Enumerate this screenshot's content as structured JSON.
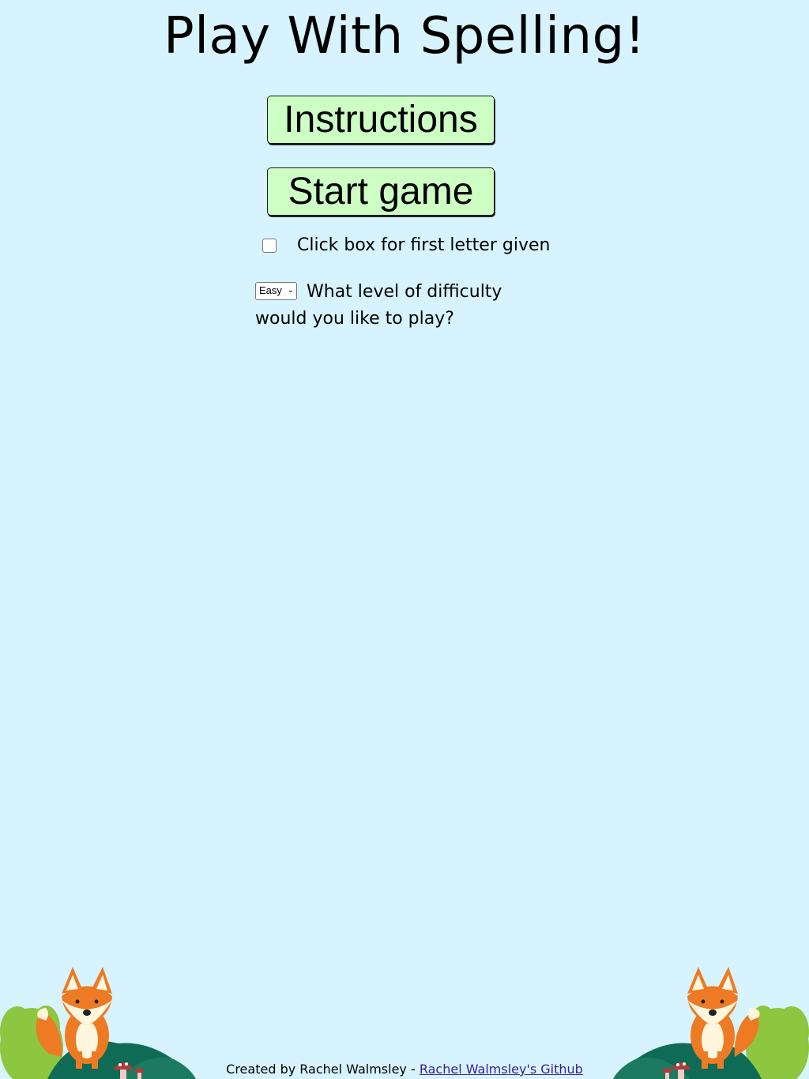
{
  "title": "Play With Spelling!",
  "buttons": {
    "instructions": "Instructions",
    "start_game": "Start game"
  },
  "first_letter": {
    "checked": false,
    "label": "Click box for first letter given"
  },
  "difficulty": {
    "selected": "Easy",
    "label": "What level of difficulty would you like to play?"
  },
  "footer": {
    "created_by": "Created by Rachel Walmsley -",
    "link_text": "Rachel Walmsley's Github"
  },
  "colors": {
    "background": "#d7f4fe",
    "button": "#cdffc5",
    "fox": "#ee7a23",
    "bush_light": "#8dc63f",
    "bush_dark": "#0f6b55",
    "link": "#3a1b8f"
  },
  "decor": {
    "left_scene": "fox-icon",
    "right_scene": "fox-icon"
  }
}
